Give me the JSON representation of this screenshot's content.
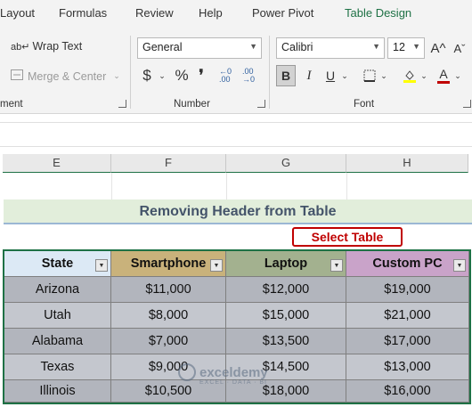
{
  "ribbon_tabs": [
    "Layout",
    "Formulas",
    "Review",
    "Help",
    "Power Pivot",
    "Table Design"
  ],
  "ribbon": {
    "wrap_text": "Wrap Text",
    "merge_center": "Merge & Center",
    "alignment_group_label": "ment",
    "number_format": "General",
    "currency_symbol": "$",
    "percent_symbol": "%",
    "comma_symbol": "❜",
    "increase_decimal": "←0 .00",
    "decrease_decimal": ".00 →0",
    "number_group_label": "Number",
    "font_name": "Calibri",
    "font_size": "12",
    "grow_font": "A^",
    "shrink_font": "Aˇ",
    "bold": "B",
    "italic": "I",
    "underline": "U",
    "font_color_letter": "A",
    "font_group_label": "Font"
  },
  "columns": [
    "E",
    "F",
    "G",
    "H"
  ],
  "title": "Removing Header from Table",
  "callout": "Select Table",
  "table": {
    "headers": [
      {
        "label": "State",
        "bg": "#dce9f5"
      },
      {
        "label": "Smartphone",
        "bg": "#c9b27b"
      },
      {
        "label": "Laptop",
        "bg": "#a3b18f"
      },
      {
        "label": "Custom PC",
        "bg": "#c9a3c9"
      }
    ],
    "rows": [
      [
        "Arizona",
        "$11,000",
        "$12,000",
        "$19,000"
      ],
      [
        "Utah",
        "$8,000",
        "$15,000",
        "$21,000"
      ],
      [
        "Alabama",
        "$7,000",
        "$13,500",
        "$17,000"
      ],
      [
        "Texas",
        "$9,000",
        "$14,500",
        "$13,000"
      ],
      [
        "Illinois",
        "$10,500",
        "$18,000",
        "$16,000"
      ]
    ]
  },
  "watermark": {
    "name": "exceldemy",
    "tagline": "EXCEL · DATA · BI"
  },
  "colors": {
    "accent": "#1e7145",
    "callout": "#c00000",
    "title_text": "#44546a"
  }
}
